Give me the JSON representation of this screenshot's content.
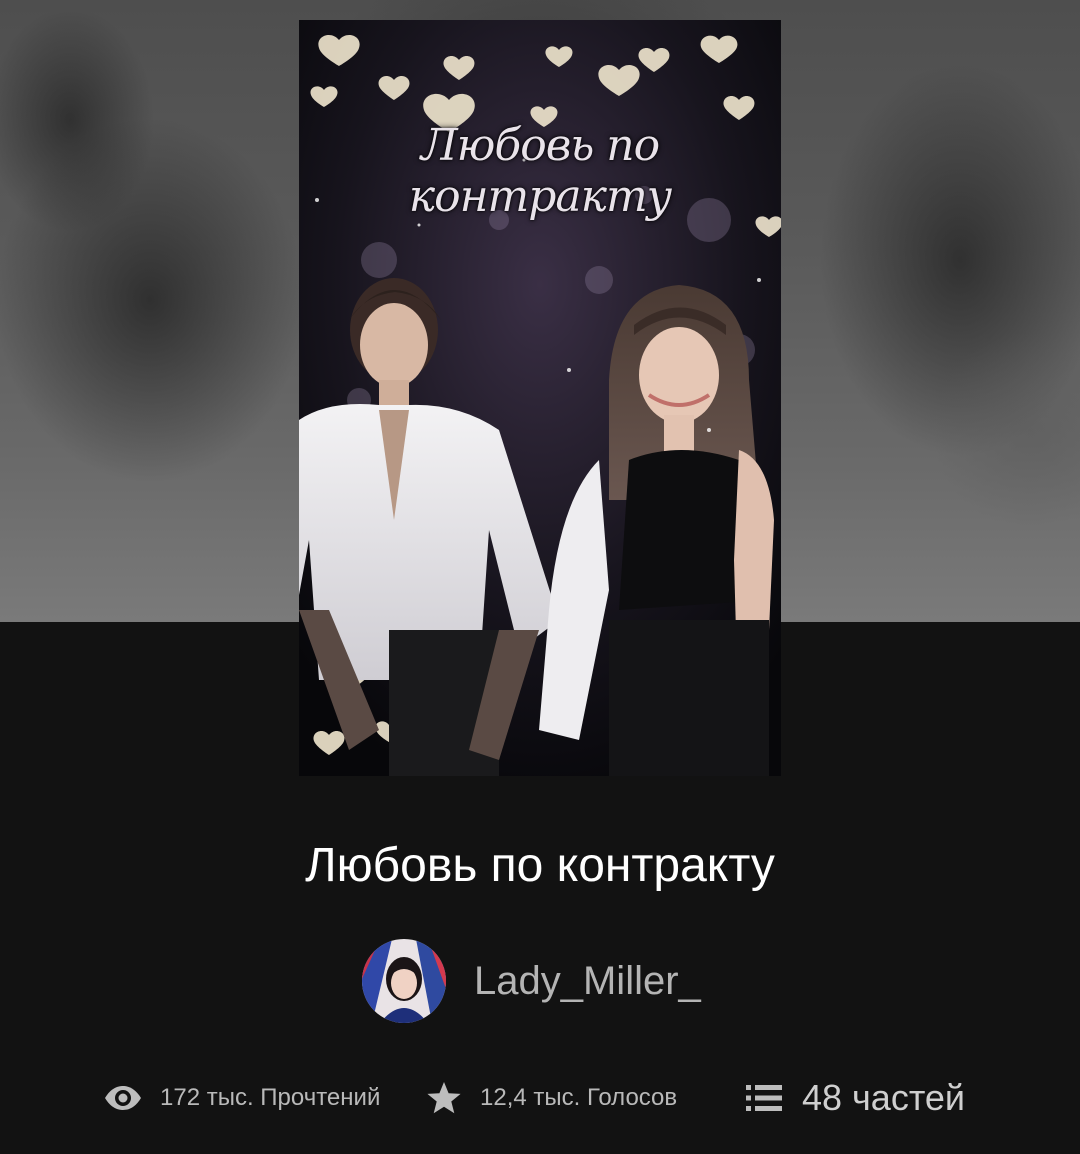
{
  "story": {
    "cover_title": "Любовь по контракту",
    "title": "Любовь по контракту",
    "author": "Lady_Miller_"
  },
  "stats": {
    "reads": "172 тыс. Прочтений",
    "votes": "12,4 тыс. Голосов",
    "parts": "48 частей"
  },
  "icons": {
    "reads": "eye-icon",
    "votes": "star-icon",
    "parts": "list-icon"
  },
  "colors": {
    "background": "#121212",
    "title": "#ffffff",
    "author": "#b4b4b4",
    "stats": "#b9b9b9"
  }
}
